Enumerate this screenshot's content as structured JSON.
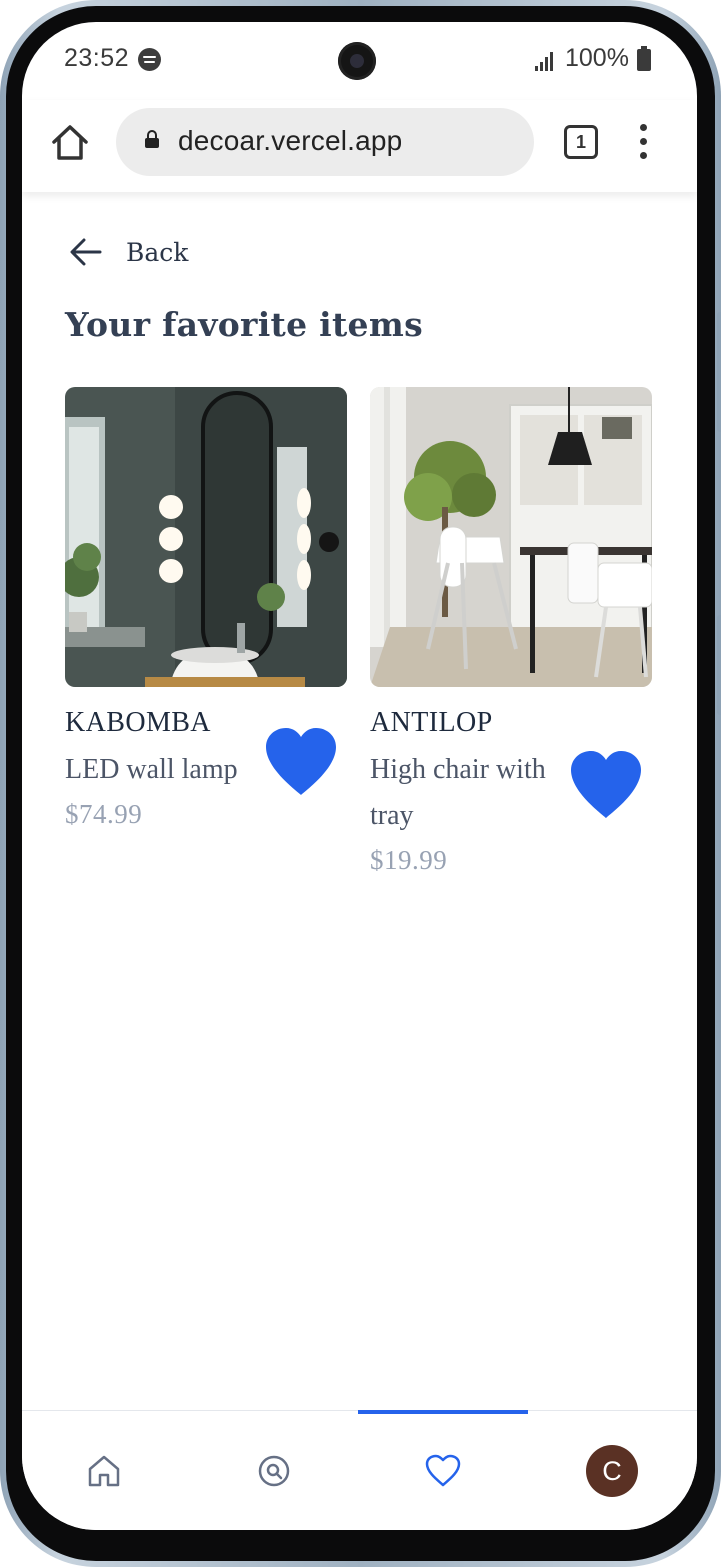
{
  "status_bar": {
    "time": "23:52",
    "battery": "100%"
  },
  "browser": {
    "url": "decoar.vercel.app",
    "tab_count": "1"
  },
  "page": {
    "back_label": "Back",
    "title": "Your favorite items"
  },
  "favorites": [
    {
      "brand": "KABOMBA",
      "description": "LED wall lamp",
      "price": "$74.99",
      "favorited": true
    },
    {
      "brand": "ANTILOP",
      "description": "High chair with tray",
      "price": "$19.99",
      "favorited": true
    }
  ],
  "bottom_nav": {
    "items": [
      "home-icon",
      "search-icon",
      "heart-icon",
      "avatar"
    ],
    "active": "heart-icon",
    "avatar_initial": "C"
  },
  "colors": {
    "accent": "#2563eb",
    "title": "#344054",
    "price": "#98a2b3",
    "avatar": "#5a3124"
  }
}
